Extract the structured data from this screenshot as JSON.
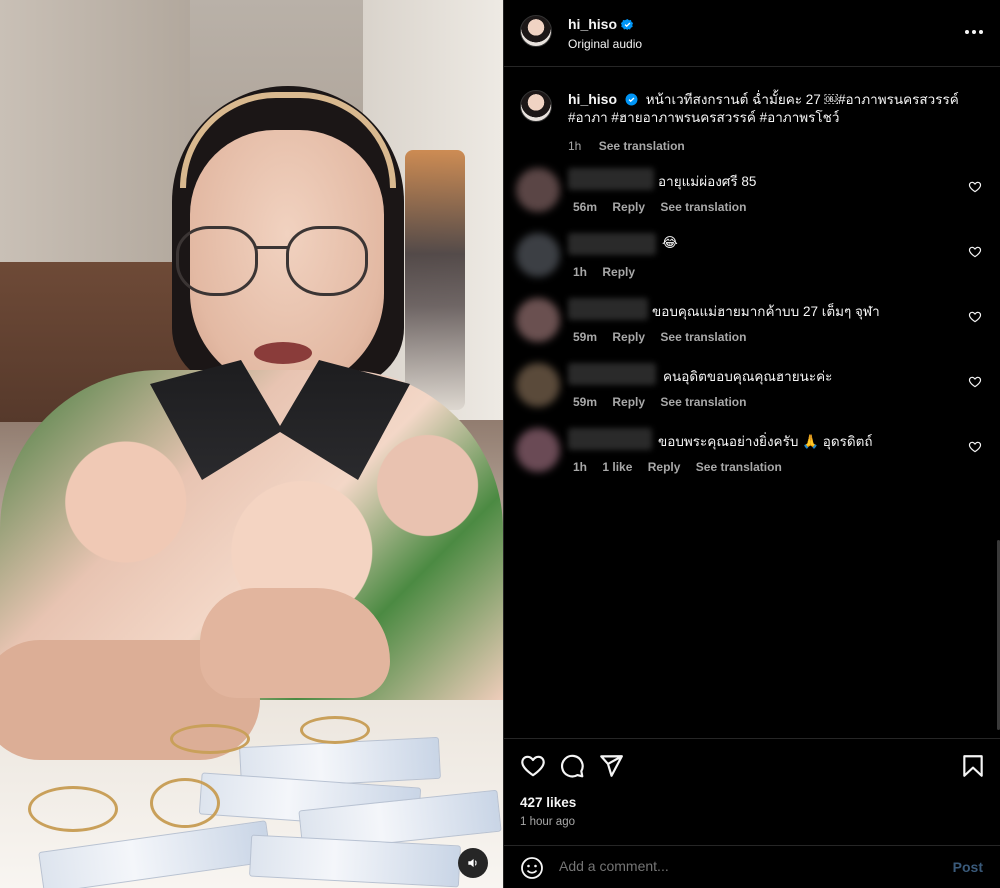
{
  "post": {
    "username": "hi_hiso",
    "subtitle": "Original audio",
    "caption": "หน้าเวทีสงกรานต์ ฉ่ำมั้ยคะ 27 ￼#อาภาพรนครสวรรค์ #อาภา #ฮายอาภาพรนครสวรรค์ #อาภาพรโชว์",
    "caption_time": "1h",
    "see_translation": "See translation",
    "likes": "427 likes",
    "time_ago": "1 hour ago"
  },
  "comments": [
    {
      "text": "อายุแม่ผ่องศรี 85",
      "time": "56m",
      "reply": "Reply",
      "translate": "See translation",
      "likes": "",
      "avatar_color": "#5a4545"
    },
    {
      "text": "😂",
      "time": "1h",
      "reply": "Reply",
      "translate": "",
      "likes": "",
      "avatar_color": "#3c3f44"
    },
    {
      "text": "ขอบคุณแม่ฮายมากค้าบบ 27 เต็มๆ จุฬา",
      "time": "59m",
      "reply": "Reply",
      "translate": "See translation",
      "likes": "",
      "avatar_color": "#6a5050"
    },
    {
      "text": "คนอุดิตขอบคุณคุณฮายนะค่ะ",
      "time": "59m",
      "reply": "Reply",
      "translate": "See translation",
      "likes": "",
      "avatar_color": "#5a4a3a"
    },
    {
      "text": "ขอบพระคุณอย่างยิ่งครับ 🙏 อุดรดิตถ์",
      "time": "1h",
      "reply": "Reply",
      "translate": "See translation",
      "likes": "1 like",
      "avatar_color": "#6a4a55"
    }
  ],
  "composer": {
    "placeholder": "Add a comment...",
    "post_label": "Post"
  },
  "icons": {
    "like": "heart-icon",
    "comment": "comment-icon",
    "share": "share-icon",
    "save": "bookmark-icon",
    "more": "more-icon",
    "emoji": "emoji-icon",
    "sound": "speaker-icon",
    "verified": "verified-badge-icon"
  },
  "colors": {
    "background": "#000000",
    "text": "#f5f5f5",
    "muted": "#a8a8a8",
    "verified": "#0095f6",
    "post_disabled": "#3a5a7a"
  }
}
